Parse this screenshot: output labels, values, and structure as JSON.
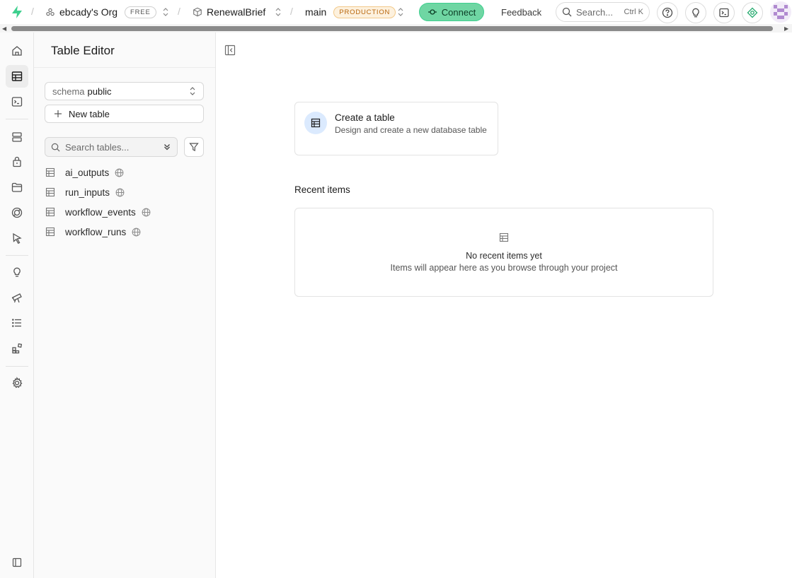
{
  "topbar": {
    "org_name": "ebcady's Org",
    "org_plan": "FREE",
    "project_name": "RenewalBrief",
    "branch_name": "main",
    "branch_env": "PRODUCTION",
    "connect_label": "Connect",
    "feedback_label": "Feedback",
    "search_placeholder": "Search...",
    "search_shortcut": "Ctrl K",
    "accent": "#3ecf8e"
  },
  "rail": {
    "items": [
      "home-icon",
      "table-editor-icon",
      "sql-editor-icon",
      "database-icon",
      "auth-icon",
      "storage-icon",
      "realtime-icon",
      "edge-functions-icon",
      "advisors-icon",
      "reports-icon",
      "logs-icon",
      "integrations-icon",
      "settings-icon",
      "collapse-sidebar-icon"
    ],
    "active": "table-editor-icon"
  },
  "panel": {
    "title": "Table Editor",
    "schema_label": "schema",
    "schema_value": "public",
    "new_table_label": "New table",
    "search_placeholder": "Search tables...",
    "tables": [
      {
        "name": "ai_outputs"
      },
      {
        "name": "run_inputs"
      },
      {
        "name": "workflow_events"
      },
      {
        "name": "workflow_runs"
      }
    ]
  },
  "main": {
    "create_title": "Create a table",
    "create_desc": "Design and create a new database table",
    "recent_title": "Recent items",
    "empty_title": "No recent items yet",
    "empty_desc": "Items will appear here as you browse through your project"
  }
}
